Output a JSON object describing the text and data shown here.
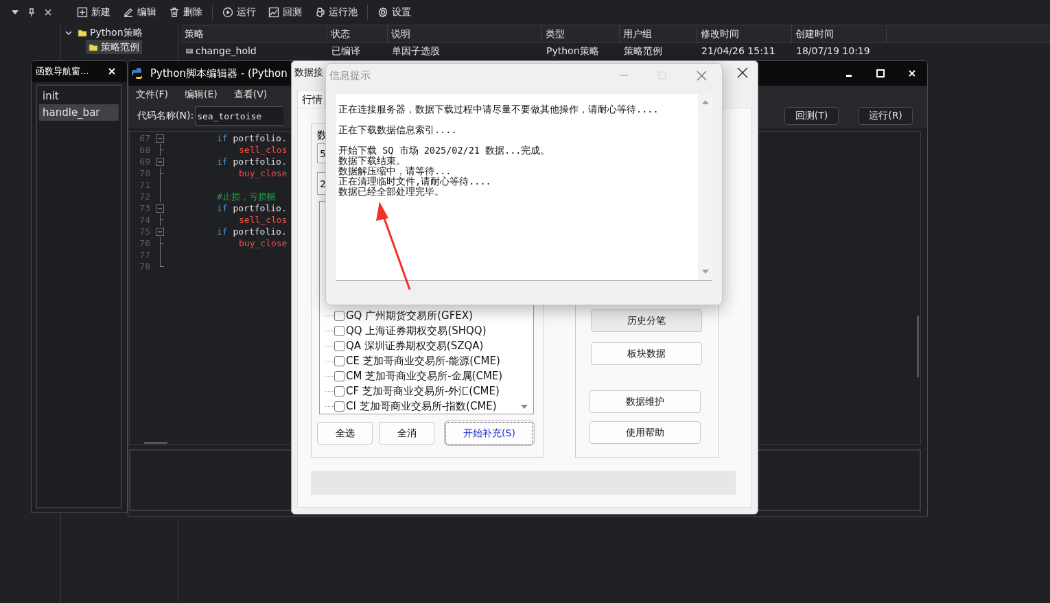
{
  "toolbar": [
    {
      "label": "新建",
      "kind": "new"
    },
    {
      "label": "编辑",
      "kind": "edit"
    },
    {
      "label": "删除",
      "kind": "delete"
    },
    {
      "label": "运行",
      "kind": "run"
    },
    {
      "label": "回测",
      "kind": "backtest"
    },
    {
      "label": "运行池",
      "kind": "pool"
    },
    {
      "label": "设置",
      "kind": "settings"
    }
  ],
  "tree": [
    {
      "label": "Python策略",
      "expanded": true,
      "selected": false,
      "children": [
        {
          "label": "策略范例",
          "selected": true
        }
      ]
    }
  ],
  "table": {
    "columns": [
      "策略",
      "状态",
      "说明",
      "类型",
      "用户组",
      "修改时间",
      "创建时间"
    ],
    "rows": [
      {
        "cells": [
          "change_hold",
          "已编译",
          "单因子选股",
          "Python策略",
          "策略范例",
          "21/04/26 15:11",
          "18/07/19 10:19"
        ]
      }
    ]
  },
  "nav_window": {
    "title": "函数导航窗...",
    "items": [
      {
        "label": "init",
        "selected": false
      },
      {
        "label": "handle_bar",
        "selected": true
      }
    ]
  },
  "editor": {
    "title": "Python脚本编辑器 - (Python",
    "menu": [
      "文件(F)",
      "编辑(E)",
      "查看(V)"
    ],
    "name_label": "代码名称(N):",
    "name_value": "sea_tortoise",
    "buttons": [
      "回测(T)",
      "运行(R)"
    ],
    "lines": [
      {
        "num": "67",
        "kind": "head",
        "tokens": [
          {
            "kind": "keyword",
            "text": "if"
          },
          {
            "kind": "plain",
            "text": " portfolio."
          }
        ]
      },
      {
        "num": "68",
        "kind": "body",
        "tokens": [
          {
            "kind": "call",
            "text": "sell_clos"
          }
        ]
      },
      {
        "num": "69",
        "kind": "head",
        "tokens": [
          {
            "kind": "keyword",
            "text": "if"
          },
          {
            "kind": "plain",
            "text": " portfolio."
          }
        ]
      },
      {
        "num": "70",
        "kind": "body",
        "tokens": [
          {
            "kind": "call",
            "text": "buy_close"
          }
        ]
      },
      {
        "num": "71",
        "kind": "blank"
      },
      {
        "num": "72",
        "kind": "head",
        "tokens": [
          {
            "kind": "comment",
            "text": "#止损，亏损幅"
          }
        ]
      },
      {
        "num": "73",
        "kind": "head",
        "tokens": [
          {
            "kind": "keyword",
            "text": "if"
          },
          {
            "kind": "plain",
            "text": " portfolio."
          }
        ]
      },
      {
        "num": "74",
        "kind": "body",
        "tokens": [
          {
            "kind": "call",
            "text": "sell_clos"
          }
        ]
      },
      {
        "num": "75",
        "kind": "head",
        "tokens": [
          {
            "kind": "keyword",
            "text": "if"
          },
          {
            "kind": "plain",
            "text": " portfolio."
          }
        ]
      },
      {
        "num": "76",
        "kind": "body",
        "tokens": [
          {
            "kind": "call",
            "text": "buy_close"
          }
        ]
      },
      {
        "num": "77",
        "kind": "blank"
      },
      {
        "num": "78",
        "kind": "blank"
      }
    ]
  },
  "data_dialog": {
    "title": "数据接",
    "tab": "行情",
    "group_label": "数",
    "fields": [
      "5",
      "2"
    ],
    "markets": [
      {
        "label": "GQ 广州期货交易所(GFEX)",
        "checked": false
      },
      {
        "label": "QQ 上海证券期权交易(SHQQ)",
        "checked": false
      },
      {
        "label": "QA 深圳证券期权交易(SZQA)",
        "checked": false
      },
      {
        "label": "CE 芝加哥商业交易所-能源(CME)",
        "checked": false
      },
      {
        "label": "CM 芝加哥商业交易所-金属(CME)",
        "checked": false
      },
      {
        "label": "CF 芝加哥商业交易所-外汇(CME)",
        "checked": false
      },
      {
        "label": "CI 芝加哥商业交易所-指数(CME)",
        "checked": false
      }
    ],
    "buttons": [
      {
        "label": "全选",
        "focused": false
      },
      {
        "label": "全消",
        "focused": false
      },
      {
        "label": "开始补充(S)",
        "focused": true
      }
    ],
    "side_buttons": [
      "历史分笔",
      "板块数据",
      "数据维护",
      "使用帮助"
    ]
  },
  "info_dialog": {
    "title": "信息提示",
    "paragraphs": [
      [
        "正在连接服务器，数据下载过程中请尽量不要做其他操作，请耐心等待...."
      ],
      [
        "正在下载数据信息索引...."
      ],
      [
        "开始下载 SQ 市场 2025/02/21 数据...完成。",
        "数据下载结束。",
        "数据解压缩中，请等待...",
        "正在清理临时文件,请耐心等待....",
        "数据已经全部处理完毕。"
      ]
    ]
  }
}
